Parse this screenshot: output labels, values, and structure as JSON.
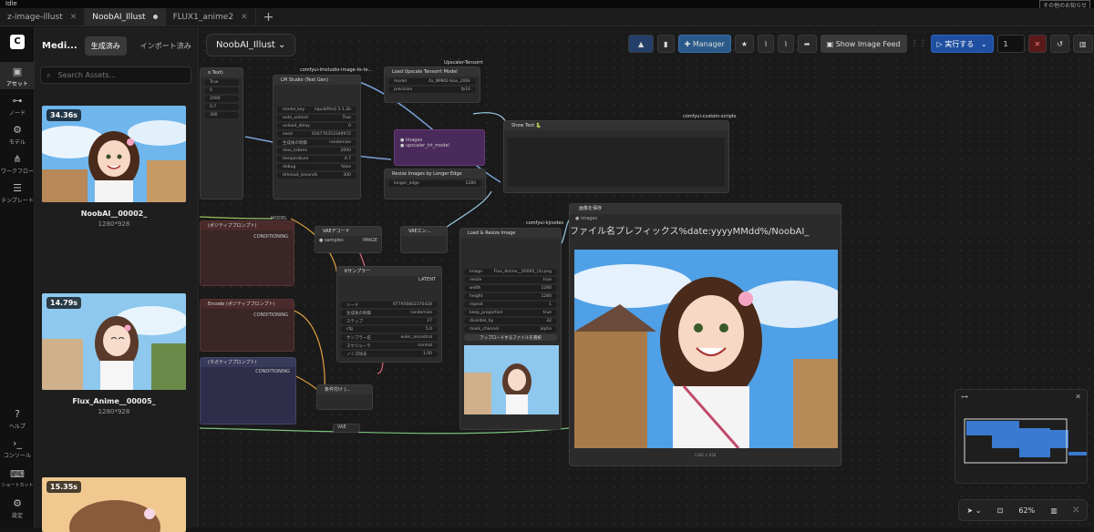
{
  "window": {
    "status": "Idle",
    "corner_hint": "その他のお知らせ"
  },
  "tabs": [
    {
      "label": "z-image-illust",
      "state": "normal"
    },
    {
      "label": "NoobAI_Illust",
      "state": "active-modified"
    },
    {
      "label": "FLUX1_anime2",
      "state": "normal"
    }
  ],
  "rail": {
    "items": [
      {
        "label": "アセット",
        "icon": "image-icon"
      },
      {
        "label": "ノード",
        "icon": "node-icon"
      },
      {
        "label": "モデル",
        "icon": "model-icon"
      },
      {
        "label": "ワークフロー",
        "icon": "workflow-icon"
      },
      {
        "label": "テンプレート",
        "icon": "template-icon"
      }
    ],
    "bottom": [
      {
        "label": "ヘルプ",
        "icon": "help-icon"
      },
      {
        "label": "コンソール",
        "icon": "console-icon"
      },
      {
        "label": "ショートカット",
        "icon": "keyboard-icon"
      },
      {
        "label": "設定",
        "icon": "gear-icon"
      }
    ]
  },
  "assets": {
    "title": "Medi...",
    "seg_generated": "生成済み",
    "seg_imported": "インポート済み",
    "search_placeholder": "Search Assets...",
    "cards": [
      {
        "time": "34.36s",
        "name": "NoobAI__00002_",
        "size": "1280*928"
      },
      {
        "time": "14.79s",
        "name": "Flux_Anime__00005_",
        "size": "1280*928"
      },
      {
        "time": "15.35s",
        "name": "",
        "size": ""
      }
    ]
  },
  "canvas": {
    "workflow_name": "NoobAI_Illust",
    "toolbar": {
      "manager": "Manager",
      "feed": "Show Image Feed",
      "run": "実行する",
      "batch": "1"
    },
    "nodes": {
      "lm_studio": "LM Studio (Text Gen)",
      "lm_tag": "comfyui-lmstudio-image-to-te...",
      "upscale_model": "Load Upscale Tensorrt Model",
      "upscale_tag": "Upscaler-Tensorrt",
      "show_text": "Show Text 🐍",
      "show_tag": "comfyui-custom-scripts",
      "resize": "Resize Images by Longer Edge",
      "load_resize": "Load & Resize Image",
      "load_tag": "comfyui-kjnodes",
      "ksampler": "Kサンプラー",
      "vae_decode": "VAEデコード",
      "vae_encode": "VAEエン...",
      "save_image": "画像を保存",
      "save_prefix": "ファイル名プレフィックス",
      "save_value": "%date:yyyyMMdd%/NoobAI_",
      "upload_button": "アップロードするファイルを選択",
      "ks_params": [
        {
          "k": "シード",
          "v": "877956802370428"
        },
        {
          "k": "生成後の制御",
          "v": "randomize"
        },
        {
          "k": "ステップ",
          "v": "27"
        },
        {
          "k": "cfg",
          "v": "5.0"
        },
        {
          "k": "サンプラー名",
          "v": "euler_ancestral"
        },
        {
          "k": "スケジューラ",
          "v": "normal"
        },
        {
          "k": "ノイズ除去",
          "v": "1.00"
        }
      ],
      "lr_params": [
        {
          "k": "image",
          "v": "Flux_Anime__00005_(3).png"
        },
        {
          "k": "resize",
          "v": "true"
        },
        {
          "k": "width",
          "v": "1280"
        },
        {
          "k": "height",
          "v": "1280"
        },
        {
          "k": "repeat",
          "v": "1"
        },
        {
          "k": "keep_proportion",
          "v": "true"
        },
        {
          "k": "divisible_by",
          "v": "32"
        },
        {
          "k": "mask_channel",
          "v": "alpha"
        }
      ],
      "lm_params": [
        {
          "k": "model_key",
          "v": "liquid/lfm2.5-1.2b"
        },
        {
          "k": "auto_unload",
          "v": "True"
        },
        {
          "k": "unload_delay",
          "v": "0"
        },
        {
          "k": "seed",
          "v": "916776353349972"
        },
        {
          "k": "生成後の制御",
          "v": "randomize"
        },
        {
          "k": "max_tokens",
          "v": "2000"
        },
        {
          "k": "temperature",
          "v": "0.7"
        },
        {
          "k": "debug",
          "v": "false"
        },
        {
          "k": "timeout_seconds",
          "v": "300"
        }
      ],
      "conditioning": "CONDITIONING",
      "latent": "LATENT",
      "image_out": "IMAGE",
      "model": "MODEL",
      "clip_encode": "Encode (ポジティブプロンプト)",
      "neg_title": "(ネガティブプロンプト)",
      "preview_size": "1280 × 928"
    },
    "zoom": "62%"
  }
}
